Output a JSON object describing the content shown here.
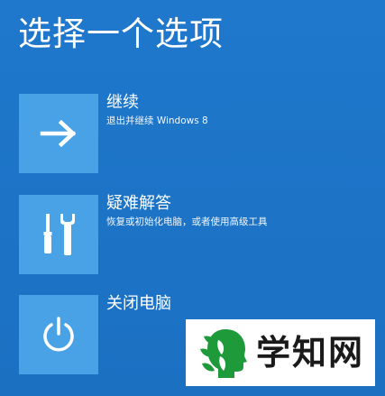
{
  "header": {
    "title": "选择一个选项"
  },
  "options": [
    {
      "title": "继续",
      "description": "退出并继续 Windows 8",
      "icon": "arrow-right-icon"
    },
    {
      "title": "疑难解答",
      "description": "恢复或初始化电脑，或者使用高级工具",
      "icon": "tools-icon"
    },
    {
      "title": "关闭电脑",
      "description": "",
      "icon": "power-icon"
    }
  ],
  "watermark": {
    "text": "学知网"
  },
  "colors": {
    "background": "#1d74c8",
    "tile": "#4aa2e6",
    "text": "#ffffff",
    "watermark_logo": "#1e9a3a"
  }
}
